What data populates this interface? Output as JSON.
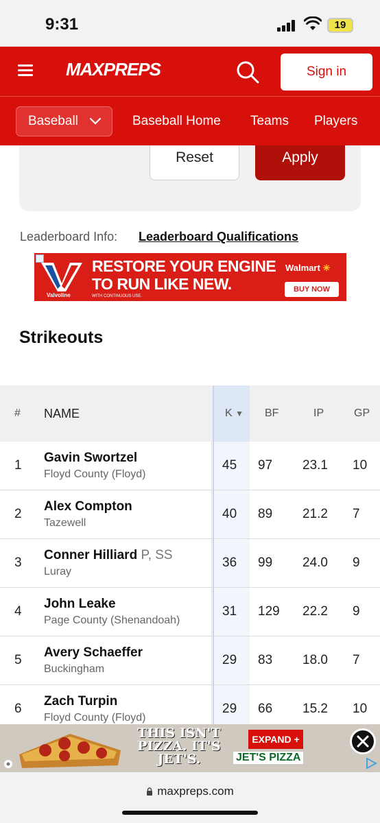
{
  "status_bar": {
    "time": "9:31",
    "battery": "19"
  },
  "header": {
    "logo": "MAXPREPS",
    "sign_in": "Sign in"
  },
  "nav": {
    "sport_select": "Baseball",
    "links": [
      "Baseball Home",
      "Teams",
      "Players"
    ]
  },
  "filters": {
    "reset_label": "Reset",
    "apply_label": "Apply"
  },
  "leaderboard_info": {
    "label": "Leaderboard Info:",
    "link": "Leaderboard Qualifications"
  },
  "ad_top": {
    "headline_1": "RESTORE YOUR ENGINE",
    "headline_2": "TO RUN LIKE NEW.",
    "fine_print": "WITH CONTINUOUS USE.",
    "advertiser": "Valvoline",
    "retailer": "Walmart",
    "cta": "BUY NOW"
  },
  "section": {
    "title": "Strikeouts"
  },
  "table": {
    "columns": {
      "rank": "#",
      "name": "NAME",
      "k": "K",
      "bf": "BF",
      "ip": "IP",
      "gp": "GP"
    },
    "sorted_column": "K",
    "rows": [
      {
        "rank": "1",
        "name": "Gavin Swortzel",
        "pos": "",
        "school": "Floyd County (Floyd)",
        "k": "45",
        "bf": "97",
        "ip": "23.1",
        "gp": "10"
      },
      {
        "rank": "2",
        "name": "Alex Compton",
        "pos": "",
        "school": "Tazewell",
        "k": "40",
        "bf": "89",
        "ip": "21.2",
        "gp": "7"
      },
      {
        "rank": "3",
        "name": "Conner Hilliard",
        "pos": "P, SS",
        "school": "Luray",
        "k": "36",
        "bf": "99",
        "ip": "24.0",
        "gp": "9"
      },
      {
        "rank": "4",
        "name": "John Leake",
        "pos": "",
        "school": "Page County (Shenandoah)",
        "k": "31",
        "bf": "129",
        "ip": "22.2",
        "gp": "9"
      },
      {
        "rank": "5",
        "name": "Avery Schaeffer",
        "pos": "",
        "school": "Buckingham",
        "k": "29",
        "bf": "83",
        "ip": "18.0",
        "gp": "7"
      },
      {
        "rank": "6",
        "name": "Zach Turpin",
        "pos": "",
        "school": "Floyd County (Floyd)",
        "k": "29",
        "bf": "66",
        "ip": "15.2",
        "gp": "10"
      }
    ]
  },
  "ad_bottom": {
    "headline": "THIS ISN'T PIZZA. IT'S JET'S.",
    "cta": "EXPAND +",
    "brand": "JET'S PIZZA"
  },
  "browser": {
    "url": "maxpreps.com"
  },
  "colors": {
    "brand_red": "#d7100c",
    "apply_red": "#b0100a",
    "sort_highlight": "#dde6f5"
  }
}
